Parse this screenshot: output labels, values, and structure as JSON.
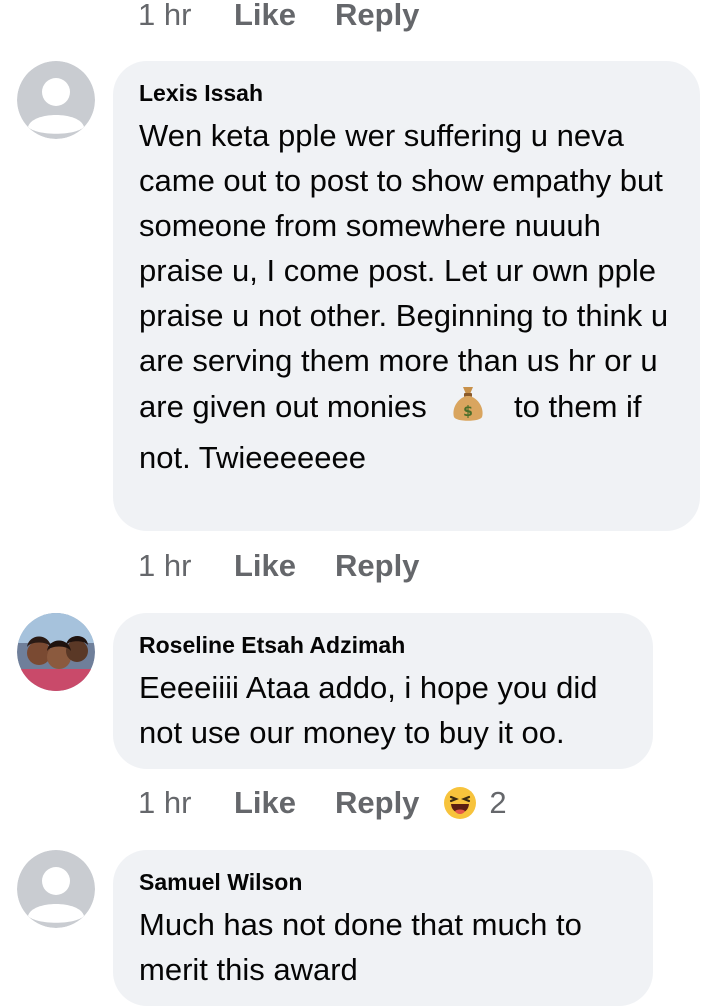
{
  "top_actions": {
    "time": "1 hr",
    "like": "Like",
    "reply": "Reply"
  },
  "comments": [
    {
      "author": "Lexis Issah",
      "text_before_emoji": "Wen keta pple wer suffering u neva came out to post to show empathy but someone from somewhere nuuuh praise u, I come post. Let ur own pple praise u not other. Beginning to think u are serving them more than us hr or u are given out monies",
      "emoji": "money-bag",
      "text_after_emoji": "to them if not. Twieeeeeee",
      "time": "1 hr",
      "like": "Like",
      "reply": "Reply"
    },
    {
      "author": "Roseline Etsah Adzimah",
      "text": "Eeeeiiii Ataa addo, i hope you did not use our money to buy it oo.",
      "time": "1 hr",
      "like": "Like",
      "reply": "Reply",
      "reaction": {
        "icon": "haha-emoji",
        "count": "2"
      }
    },
    {
      "author": "Samuel Wilson",
      "text": "Much has not done that much to merit this award"
    }
  ],
  "colors": {
    "bubble": "#f0f2f5",
    "secondary_text": "#65676b",
    "primary_text": "#050505",
    "placeholder_avatar": "#c9ccd1"
  }
}
